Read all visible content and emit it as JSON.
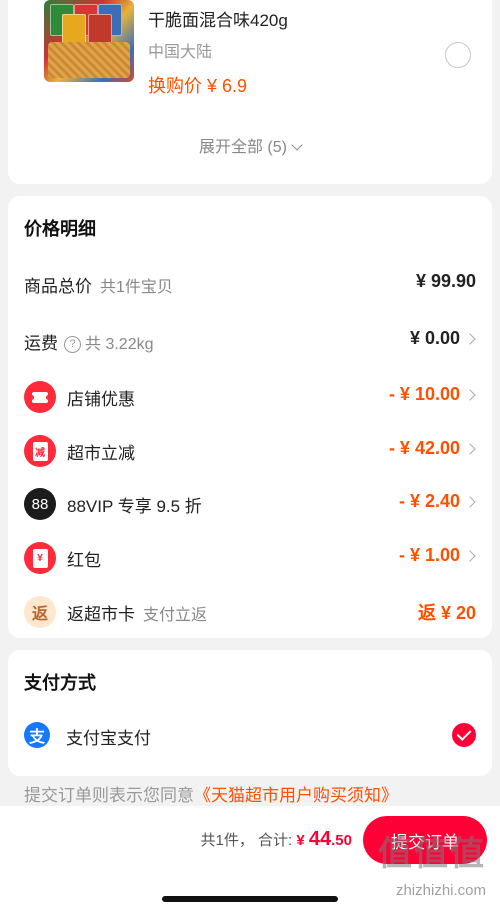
{
  "product": {
    "title": "干脆面混合味420g",
    "origin": "中国大陆",
    "price": "换购价 ¥ 6.9",
    "expand": "展开全部 (5)"
  },
  "price_detail": {
    "title": "价格明细",
    "rows": [
      {
        "label": "商品总价",
        "sub": "共1件宝贝",
        "value": "¥ 99.90"
      },
      {
        "label": "运费",
        "sub": "共 3.22kg",
        "value": "¥ 0.00"
      },
      {
        "label": "店铺优惠",
        "value": "- ¥ 10.00",
        "icon": "coupon-ticket-icon"
      },
      {
        "label": "超市立减",
        "value": "- ¥ 42.00",
        "icon": "discount-envelope-icon",
        "icon_text": "减"
      },
      {
        "label": "88VIP 专享 9.5 折",
        "value": "- ¥ 2.40",
        "icon": "vip88-icon",
        "icon_text": "88"
      },
      {
        "label": "红包",
        "value": "- ¥ 1.00",
        "icon": "red-packet-icon",
        "icon_text": "¥"
      },
      {
        "label": "返超市卡",
        "sub": "支付立返",
        "value": "返 ¥ 20",
        "icon": "cashback-icon",
        "icon_text": "返"
      }
    ]
  },
  "payment": {
    "title": "支付方式",
    "method": "支付宝支付",
    "icon_text": "支"
  },
  "agreement": {
    "text": "提交订单则表示您同意",
    "link": "《天猫超市用户购买须知》"
  },
  "bottom": {
    "count": "共1件，",
    "total_label": "合计:",
    "currency": "¥ ",
    "total_int": "44",
    "total_dec": ".50",
    "submit": "提交订单"
  },
  "watermark": {
    "text": "值值值",
    "url": "zhizhizhi.com"
  },
  "colors": {
    "accent": "#ff0036",
    "price_orange": "#ff5000",
    "alipay_blue": "#1677ff"
  }
}
